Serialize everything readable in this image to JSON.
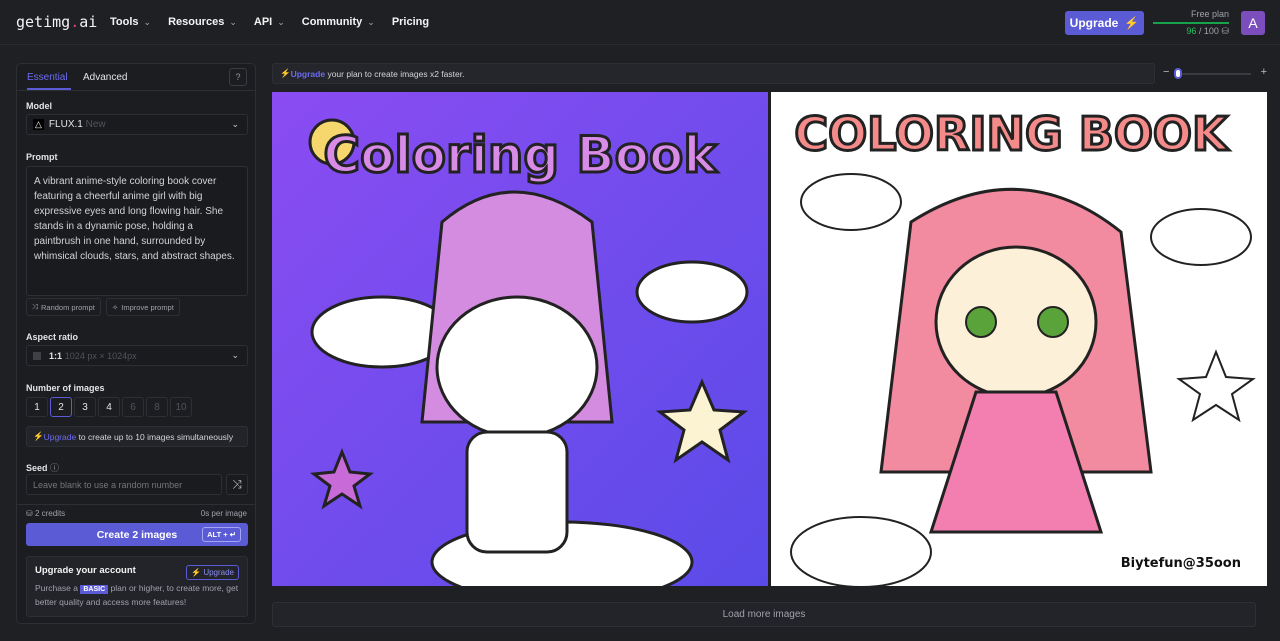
{
  "header": {
    "logo_main": "getimg",
    "logo_dot": ".",
    "logo_tld": "ai",
    "nav": [
      {
        "label": "Tools",
        "dropdown": true
      },
      {
        "label": "Resources",
        "dropdown": true
      },
      {
        "label": "API",
        "dropdown": true
      },
      {
        "label": "Community",
        "dropdown": true
      },
      {
        "label": "Pricing",
        "dropdown": false
      }
    ],
    "upgrade_label": "Upgrade",
    "plan_label": "Free plan",
    "credits_used": "96",
    "credits_total": "/ 100",
    "credits_fraction": 0.96,
    "avatar_letter": "A"
  },
  "panel": {
    "tabs": [
      "Essential",
      "Advanced"
    ],
    "active_tab": "Essential",
    "model_label": "Model",
    "model_value": "FLUX.1",
    "model_badge": "New",
    "prompt_label": "Prompt",
    "prompt_value": "A vibrant anime-style coloring book cover featuring a cheerful anime girl with big expressive eyes and long flowing hair. She stands in a dynamic pose, holding a paintbrush in one hand, surrounded by whimsical clouds, stars, and abstract shapes.",
    "random_prompt": "Random prompt",
    "improve_prompt": "Improve prompt",
    "aspect_label": "Aspect ratio",
    "aspect_value": "1:1",
    "aspect_size": "1024 px × 1024px",
    "num_label": "Number of images",
    "num_options": [
      "1",
      "2",
      "3",
      "4",
      "6",
      "8",
      "10"
    ],
    "num_selected": "2",
    "num_disabled": [
      "6",
      "8",
      "10"
    ],
    "num_upgrade_link": "Upgrade",
    "num_upgrade_text": " to create up to 10 images simultaneously",
    "seed_label": "Seed",
    "seed_placeholder": "Leave blank to use a random number",
    "credits": "2 credits",
    "per_image": "0s per image",
    "create_label": "Create 2 images",
    "create_shortcut": "ALT + ↵",
    "account_title": "Upgrade your account",
    "account_upgrade": "Upgrade",
    "account_text_1": "Purchase a ",
    "account_badge": "BASIC",
    "account_text_2": " plan or higher, to create more, get better quality and access more features!"
  },
  "main": {
    "banner_link": "Upgrade",
    "banner_text": " your plan to create images x2 faster.",
    "zoom_minus": "−",
    "zoom_plus": "+",
    "zoom_level": 0,
    "images": [
      {
        "title_text": "COLORING BOOK",
        "bg": "#7a4cf0"
      },
      {
        "title_text": "COLORING BOOK",
        "watermark": "Biytefun@35oon",
        "bg": "#ffffff"
      }
    ],
    "load_more": "Load more images"
  },
  "colors": {
    "accent": "#5b5bd6",
    "green": "#22c55e",
    "bg": "#1f2024"
  }
}
